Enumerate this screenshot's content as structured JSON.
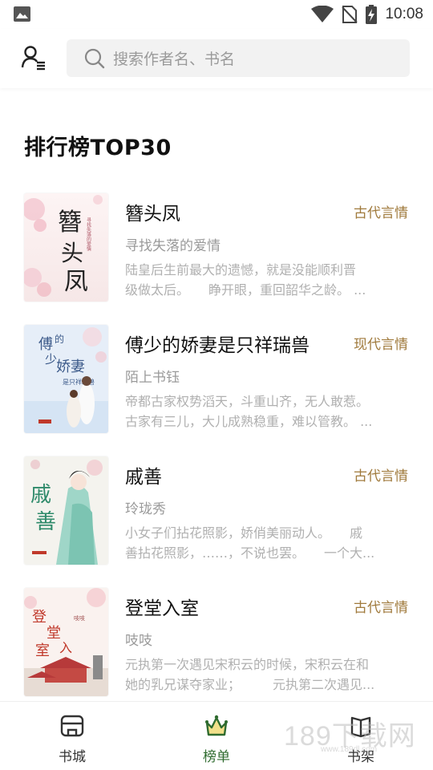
{
  "status_bar": {
    "time": "10:08",
    "icons": [
      "image-icon",
      "wifi-icon",
      "no-sim-icon",
      "battery-charging-icon"
    ]
  },
  "header": {
    "profile_icon": "user-list-icon",
    "search": {
      "placeholder": "搜索作者名、书名",
      "icon": "search-icon"
    }
  },
  "section": {
    "title": "排行榜TOP30"
  },
  "books": [
    {
      "title": "簪头凤",
      "genre": "古代言情",
      "author": "寻找失落的爱情",
      "desc_line1": "陆皇后生前最大的遗憾，就是没能顺利晋",
      "desc_line2": "级做太后。　　睁开眼，重回韶华之龄。 ...",
      "cover_text": "簪头凤"
    },
    {
      "title": "傅少的娇妻是只祥瑞兽",
      "genre": "现代言情",
      "author": "陌上书钰",
      "desc_line1": "帝都古家权势滔天，斗重山齐，无人敢惹。",
      "desc_line2": "古家有三儿，大儿成熟稳重，难以管教。 ...",
      "cover_text": "傅少的娇妻"
    },
    {
      "title": "戚善",
      "genre": "古代言情",
      "author": "玲珑秀",
      "desc_line1": "小女子们拈花照影，娇俏美丽动人。　　戚",
      "desc_line2": "善拈花照影，……，不说也罢。　　一个大...",
      "cover_text": "戚善"
    },
    {
      "title": "登堂入室",
      "genre": "古代言情",
      "author": "吱吱",
      "desc_line1": "元执第一次遇见宋积云的时候，宋积云在和",
      "desc_line2": "她的乳兄谋夺家业；　　　元执第二次遇见...",
      "cover_text": "登堂入室"
    }
  ],
  "bottom_nav": [
    {
      "label": "书城",
      "icon": "bookstore-icon",
      "active": false
    },
    {
      "label": "榜单",
      "icon": "crown-icon",
      "active": true
    },
    {
      "label": "书架",
      "icon": "bookshelf-icon",
      "active": false
    }
  ],
  "colors": {
    "genre": "#a07a3c",
    "active_nav": "#2f6b2f",
    "search_bg": "#f2f2f2"
  },
  "watermark": {
    "text": "189下载网",
    "sub": "www.189dl.com"
  }
}
